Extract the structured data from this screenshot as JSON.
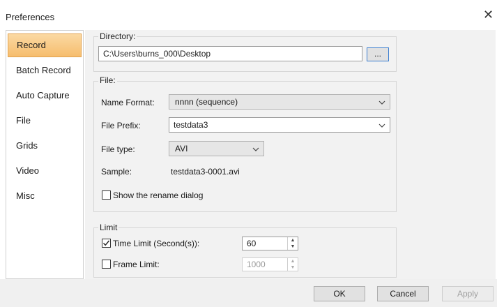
{
  "window": {
    "title": "Preferences",
    "close_glyph": "✕"
  },
  "sidebar": {
    "items": [
      {
        "label": "Record",
        "active": true
      },
      {
        "label": "Batch Record",
        "active": false
      },
      {
        "label": "Auto Capture",
        "active": false
      },
      {
        "label": "File",
        "active": false
      },
      {
        "label": "Grids",
        "active": false
      },
      {
        "label": "Video",
        "active": false
      },
      {
        "label": "Misc",
        "active": false
      }
    ]
  },
  "directory": {
    "group_label": "Directory:",
    "path": "C:\\Users\\burns_000\\Desktop",
    "browse_label": "..."
  },
  "file": {
    "group_label": "File:",
    "name_format_label": "Name Format:",
    "name_format_value": "nnnn (sequence)",
    "file_prefix_label": "File Prefix:",
    "file_prefix_value": "testdata3",
    "file_type_label": "File type:",
    "file_type_value": "AVI",
    "sample_label": "Sample:",
    "sample_value": "testdata3-0001.avi",
    "rename_dialog_label": "Show the rename dialog",
    "rename_dialog_checked": false
  },
  "limit": {
    "group_label": "Limit",
    "time_limit_label": "Time Limit (Second(s)):",
    "time_limit_checked": true,
    "time_limit_value": "60",
    "frame_limit_label": "Frame Limit:",
    "frame_limit_checked": false,
    "frame_limit_value": "1000"
  },
  "footer": {
    "ok_label": "OK",
    "cancel_label": "Cancel",
    "apply_label": "Apply"
  }
}
